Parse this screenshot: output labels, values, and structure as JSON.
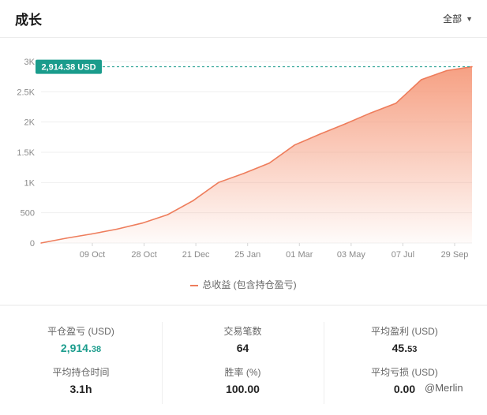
{
  "header": {
    "title": "成长",
    "filter_label": "全部"
  },
  "chart_data": {
    "type": "area",
    "ylim": [
      0,
      3000
    ],
    "y_ticks": [
      0,
      500,
      1000,
      1500,
      2000,
      2500,
      3000
    ],
    "y_tick_labels": [
      "0",
      "500",
      "1K",
      "1.5K",
      "2K",
      "2.5K",
      "3K"
    ],
    "x_tick_labels": [
      "09 Oct",
      "28 Oct",
      "21 Dec",
      "25 Jan",
      "01 Mar",
      "03 May",
      "07 Jul",
      "29 Sep"
    ],
    "series": [
      {
        "name": "总收益 (包含持仓盈亏)",
        "values": [
          0,
          80,
          150,
          230,
          330,
          470,
          700,
          1000,
          1150,
          1320,
          1620,
          1800,
          1970,
          2150,
          2310,
          2700,
          2850,
          2914.38
        ]
      }
    ],
    "last_value_label": "2,914.38 USD",
    "line_color": "#ee7d5c",
    "fill_color": "#f6a083",
    "marker_color": "#1a9c8c",
    "grid": true
  },
  "legend": {
    "label": "总收益 (包含持仓盈亏)"
  },
  "stats": [
    {
      "label": "平仓盈亏 (USD)",
      "int": "2,914.",
      "dec": "38",
      "highlight": true
    },
    {
      "label": "交易笔数",
      "int": "64",
      "dec": "",
      "highlight": false
    },
    {
      "label": "平均盈利 (USD)",
      "int": "45.",
      "dec": "53",
      "highlight": false
    },
    {
      "label": "平均持仓时间",
      "int": "3.1h",
      "dec": "",
      "highlight": false
    },
    {
      "label": "胜率 (%)",
      "int": "100.00",
      "dec": "",
      "highlight": false
    },
    {
      "label": "平均亏损 (USD)",
      "int": "0.00",
      "dec": "",
      "highlight": false
    }
  ],
  "watermark": "@Merlin"
}
